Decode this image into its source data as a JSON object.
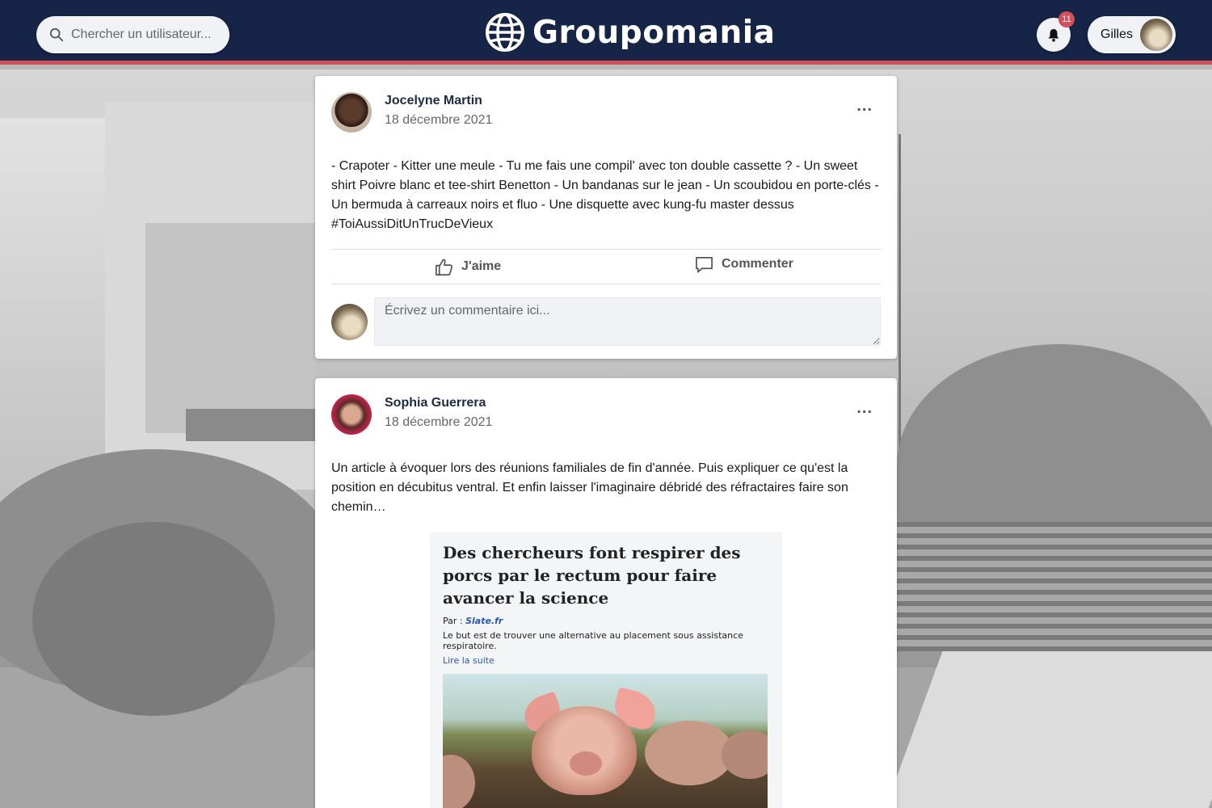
{
  "header": {
    "search_placeholder": "Chercher un utilisateur...",
    "brand_name": "Groupomania",
    "notifications_count": "11",
    "user_name": "Gilles"
  },
  "colors": {
    "header_bg": "#152447",
    "accent": "#d1515a"
  },
  "posts": [
    {
      "author": "Jocelyne Martin",
      "date": "18 décembre 2021",
      "more_label": "...",
      "text": "- Crapoter - Kitter une meule - Tu me fais une compil' avec ton double cassette ? - Un sweet shirt Poivre blanc et tee-shirt Benetton - Un bandanas sur le jean - Un scoubidou en porte-clés - Un bermuda à carreaux noirs et fluo - Une disquette avec kung-fu master dessus #ToiAussiDitUnTrucDeVieux",
      "like_label": "J'aime",
      "comment_label": "Commenter",
      "comment_placeholder": "Écrivez un commentaire ici..."
    },
    {
      "author": "Sophia Guerrera",
      "date": "18 décembre 2021",
      "more_label": "...",
      "text": "Un article à évoquer lors des réunions familiales de fin d'année. Puis expliquer ce qu'est la position en décubitus ventral. Et enfin laisser l'imaginaire débridé des réfractaires faire son chemin…",
      "article": {
        "title": "Des chercheurs font respirer des porcs par le rectum pour faire avancer la science",
        "byline_prefix": "Par : ",
        "source": "Slate.fr",
        "summary": "Le but est de trouver une alternative au placement sous assistance respiratoire.",
        "read_more": "Lire la suite"
      }
    }
  ]
}
